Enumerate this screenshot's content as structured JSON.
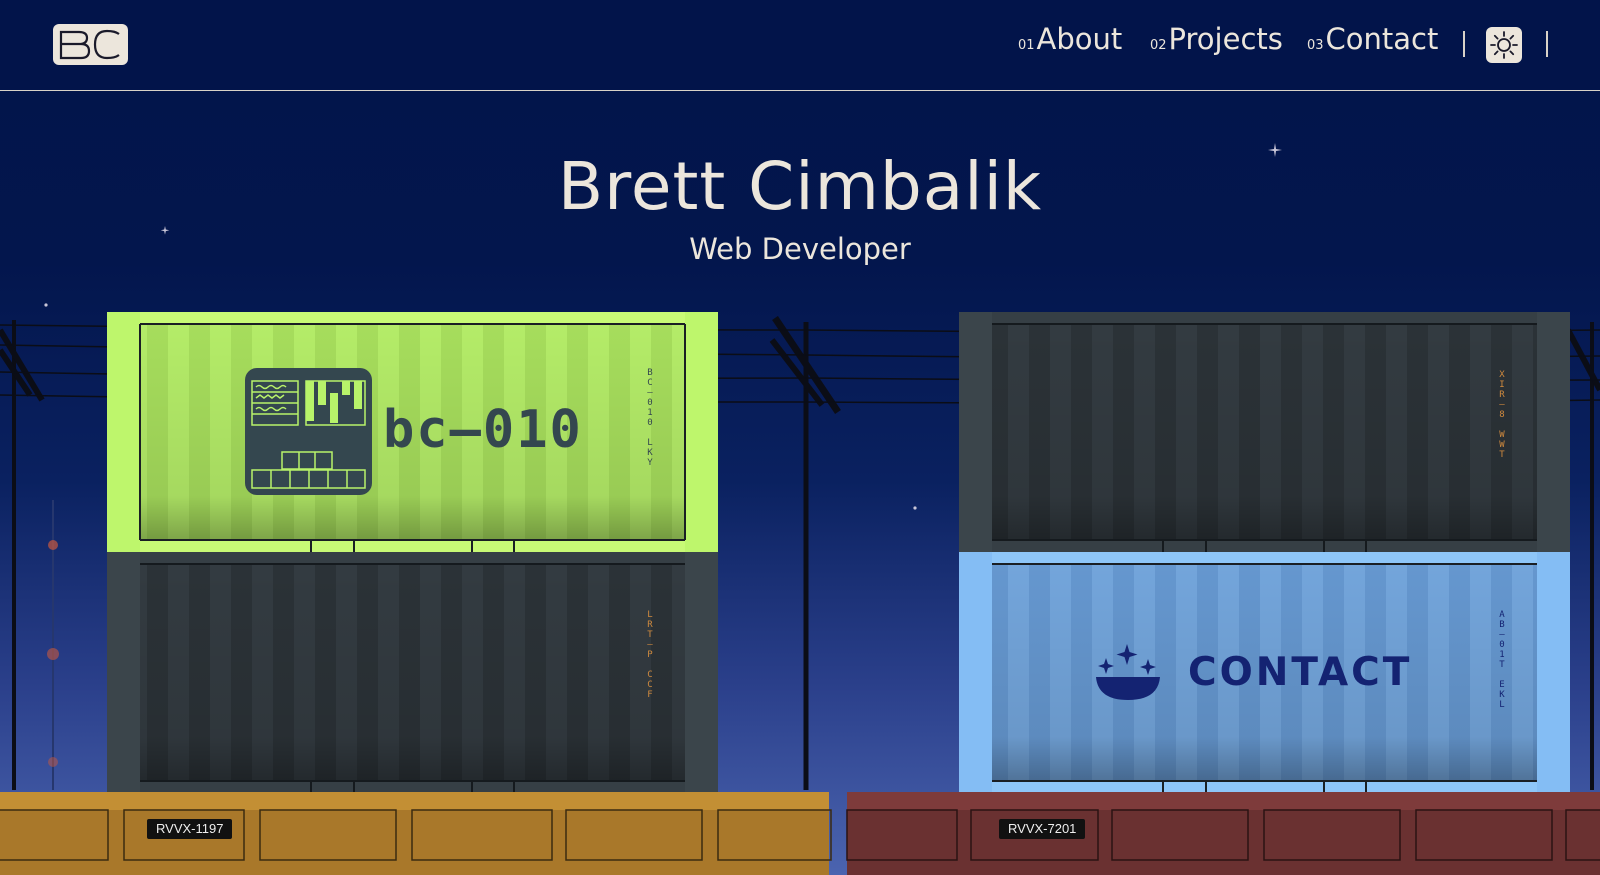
{
  "header": {
    "logo_text": "BC",
    "nav": [
      {
        "num": "01",
        "label": "About"
      },
      {
        "num": "02",
        "label": "Projects"
      },
      {
        "num": "03",
        "label": "Contact"
      }
    ],
    "theme_icon": "sun-icon"
  },
  "hero": {
    "title": "Brett Cimbalik",
    "subtitle": "Web Developer"
  },
  "containers": {
    "green": {
      "main": "bc—010",
      "side": "BC—010 LKY",
      "color": "#b8f36a",
      "frame": "#bef66c"
    },
    "dark_left": {
      "side": "LRT—P CCF",
      "color": "#2f373c"
    },
    "dark_right": {
      "side": "XIR—8 WWT",
      "color": "#2f373c"
    },
    "blue": {
      "main": "CONTACT",
      "side": "AB—01T EKL",
      "color": "#6e9fd6",
      "frame": "#84bdf4"
    }
  },
  "cars": {
    "left_tag": "RVVX-1197",
    "right_tag": "RVVX-7201",
    "left_color": "#b8852f",
    "right_color": "#7a3a3a"
  },
  "colors": {
    "background": "#02144a",
    "text": "#ece6dc",
    "accent_orange": "#d08a3e"
  }
}
